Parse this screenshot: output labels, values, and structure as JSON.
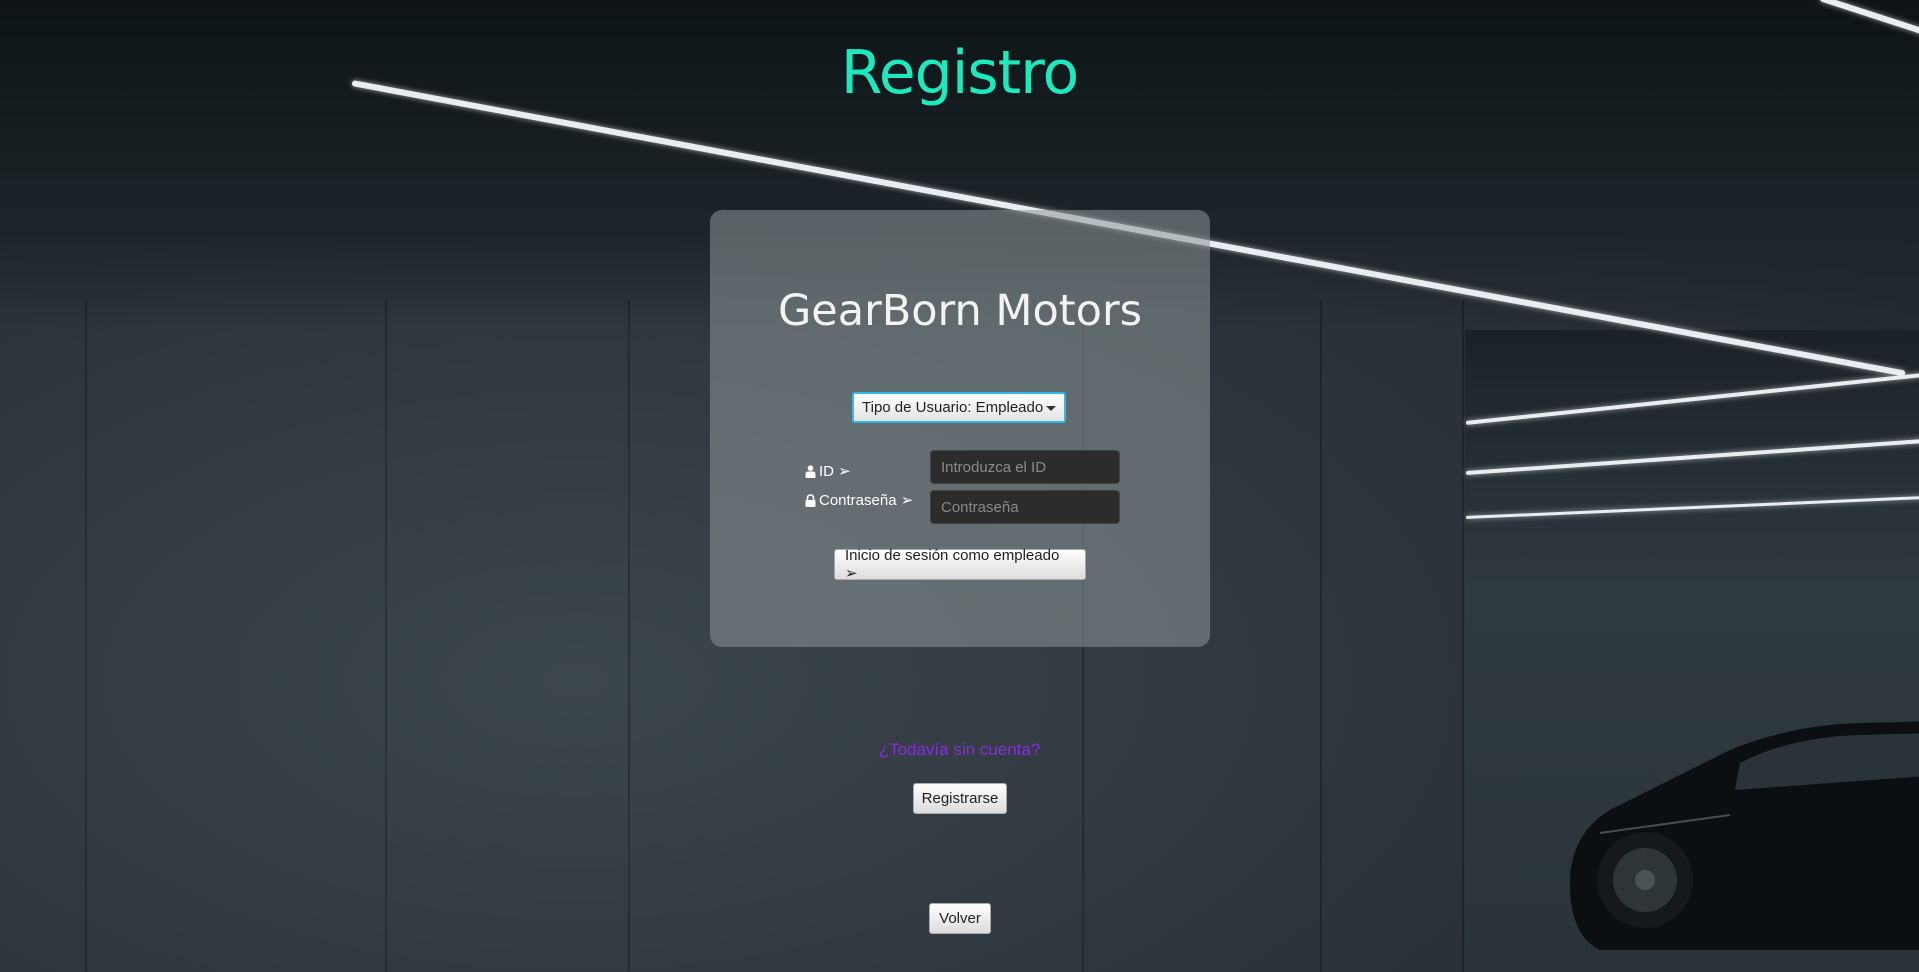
{
  "page_title": "Registro",
  "brand": "GearBorn Motors",
  "user_type_select": {
    "value": "Tipo de Usuario: Empleado"
  },
  "fields": {
    "id_label": "ID ➢",
    "id_placeholder": "Introduzca el ID",
    "password_label": "Contraseña ➢",
    "password_placeholder": "Contraseña"
  },
  "login_button": "Inicio de sesión como empleado ➢",
  "no_account_text": "¿Todavía sin cuenta?",
  "register_button": "Registrarse",
  "back_button": "Volver",
  "colors": {
    "title": "#1de9c0",
    "link": "#8a2be2",
    "focus": "#33b7e6"
  },
  "icons": {
    "id": "person-icon",
    "password": "lock-icon",
    "select": "chevron-down-icon"
  }
}
